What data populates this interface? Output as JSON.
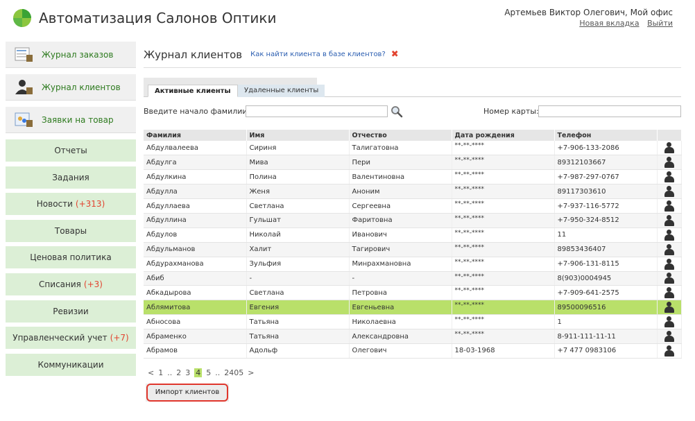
{
  "app": {
    "title": "Автоматизация Салонов Оптики"
  },
  "user": {
    "name": "Артемьев Виктор Олегович, Мой офис",
    "new_tab": "Новая вкладка",
    "logout": "Выйти"
  },
  "sidebar": {
    "main": [
      {
        "label": "Журнал заказов",
        "icon": "orders-journal-icon"
      },
      {
        "label": "Журнал клиентов",
        "icon": "clients-journal-icon"
      },
      {
        "label": "Заявки на товар",
        "icon": "product-requests-icon"
      }
    ],
    "items": [
      {
        "label": "Отчеты",
        "count": ""
      },
      {
        "label": "Задания",
        "count": ""
      },
      {
        "label": "Новости",
        "count": "(+313)"
      },
      {
        "label": "Товары",
        "count": ""
      },
      {
        "label": "Ценовая политика",
        "count": ""
      },
      {
        "label": "Списания",
        "count": "(+3)"
      },
      {
        "label": "Ревизии",
        "count": ""
      },
      {
        "label": "Управленческий учет",
        "count": "(+7)"
      },
      {
        "label": "Коммуникации",
        "count": ""
      }
    ]
  },
  "page": {
    "title": "Журнал клиентов",
    "help": "Как найти клиента в базе клиентов?",
    "close": "✖"
  },
  "tabs": {
    "active": "Активные клиенты",
    "deleted": "Удаленные клиенты"
  },
  "search": {
    "surname_label": "Введите начало фамилии:",
    "surname_value": "",
    "card_label": "Номер карты:",
    "card_value": ""
  },
  "table": {
    "headers": [
      "Фамилия",
      "Имя",
      "Отчество",
      "Дата рождения",
      "Телефон",
      ""
    ],
    "rows": [
      [
        "Абдулвалеева",
        "Сириня",
        "Талигатовна",
        "**-**-****",
        "+7-906-133-2086"
      ],
      [
        "Абдулга",
        "Мива",
        "Пери",
        "**-**-****",
        "89312103667"
      ],
      [
        "Абдулкина",
        "Полина",
        "Валентиновна",
        "**-**-****",
        "+7-987-297-0767"
      ],
      [
        "Абдулла",
        "Женя",
        "Аноним",
        "**-**-****",
        "89117303610"
      ],
      [
        "Абдуллаева",
        "Светлана",
        "Сергеевна",
        "**-**-****",
        "+7-937-116-5772"
      ],
      [
        "Абдуллина",
        "Гульшат",
        "Фаритовна",
        "**-**-****",
        "+7-950-324-8512"
      ],
      [
        "Абдулов",
        "Николай",
        "Иванович",
        "**-**-****",
        "11"
      ],
      [
        "Абдульманов",
        "Халит",
        "Тагирович",
        "**-**-****",
        "89853436407"
      ],
      [
        "Абдурахманова",
        "Зульфия",
        "Минрахмановна",
        "**-**-****",
        "+7-906-131-8115"
      ],
      [
        "Абиб",
        "-",
        "-",
        "**-**-****",
        "8(903)0004945"
      ],
      [
        "Абкадырова",
        "Светлана",
        "Петровна",
        "**-**-****",
        "+7-909-641-2575"
      ],
      [
        "Аблямитова",
        "Евгения",
        "Евгеньевна",
        "**-**-****",
        "89500096516"
      ],
      [
        "Абносова",
        "Татьяна",
        "Николаевна",
        "**-**-****",
        "1"
      ],
      [
        "Абраменко",
        "Татьяна",
        "Александровна",
        "**-**-****",
        "8-911-111-11-11"
      ],
      [
        "Абрамов",
        "Адольф",
        "Олегович",
        "18-03-1968",
        "+7 477 0983106"
      ]
    ],
    "selected_row": 11
  },
  "pagination": {
    "prev": "<",
    "items": [
      "1",
      "..",
      "2",
      "3",
      "4",
      "5",
      "..",
      "2405"
    ],
    "current": "4",
    "next": ">"
  },
  "import_button": "Импорт клиентов",
  "colors": {
    "accent_green": "#b9e06a",
    "sidebar_green": "#dcefd6",
    "alert_red": "#e2432f"
  }
}
